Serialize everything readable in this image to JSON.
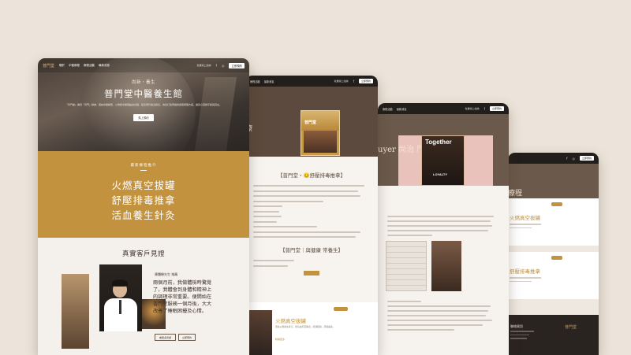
{
  "panel1": {
    "logo": "普門堂",
    "nav": [
      "關於",
      "中醫療程",
      "療程活動",
      "最新消息"
    ],
    "contact": "免費線上諮詢",
    "cta": "立即預約",
    "hero": {
      "eyebrow": "尚新・養生",
      "title": "普門堂中醫養生館",
      "description": "「普門堂」秉持「普門」精神，廣納中醫精華，以傳統中醫理論為基礎，結合現代養生觀念，為您打造專屬的健康調理方案，讓身心回歸平衡與自在。",
      "button": "馬上預約"
    },
    "featured": {
      "label": "最新療程推介",
      "lines": [
        "火燃真空拔罐",
        "舒壓排毒推拿",
        "活血養生針灸"
      ]
    },
    "testimonials": {
      "title": "真實客戶見證",
      "name": "陳體驗先生 推薦",
      "quote": "兩個月前，我做體檢時驚覺了，我體會到身體和精神上的調理非常重要。便開始在普門堂服務一個月後，大大改善了睡眠困擾及心情。",
      "button_more": "看更多見證",
      "button_book": "立即預約"
    }
  },
  "panel2": {
    "hero_text": "療",
    "poster_title": "普門堂",
    "section_title": "【普門堂・😊舒壓排毒推拿】",
    "section_title2": "【普門堂｜與健康 常養生】",
    "card": {
      "title": "火燃真空拔罐",
      "desc": "透過火燃產生真空，將氣血引至體表，疏通經絡、舒緩痠痛。",
      "link": "瞭解更多"
    }
  },
  "panel3": {
    "hero_text": "uyer 尚治 門堂 後 習",
    "magazine_title": "Together",
    "magazine_tagline": "LOYALTY"
  },
  "panel4": {
    "hero_text": "療程",
    "cards": [
      "火燃真空拔罐",
      "舒壓排毒推拿"
    ],
    "footer_title": "聯絡資訊",
    "footer_logo": "普門堂"
  },
  "colors": {
    "background": "#ece4da",
    "gold": "#c2923e",
    "dark": "#221e1b",
    "brown": "#6b5a4c"
  }
}
